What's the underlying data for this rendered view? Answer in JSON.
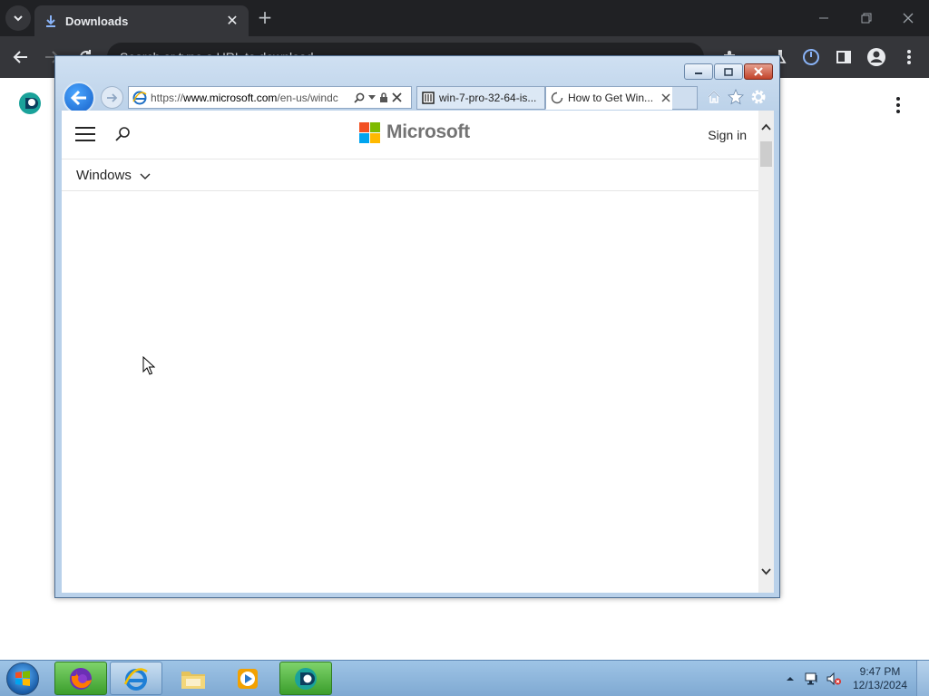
{
  "chrome": {
    "tab_title": "Downloads",
    "omnibox_text": "Search or type a URL to download",
    "colors": {
      "frame": "#202124",
      "toolbar": "#35363a",
      "text": "#e8eaed"
    }
  },
  "ie": {
    "address_url_prefix": "https://",
    "address_url_domain": "www.microsoft.com",
    "address_url_path": "/en-us/windc",
    "tabs": [
      {
        "label": "win-7-pro-32-64-is...",
        "icon": "archive-icon",
        "active": false
      },
      {
        "label": "How to Get Win...",
        "icon": "loading-spinner-icon",
        "active": true
      }
    ]
  },
  "microsoft_page": {
    "logo_text": "Microsoft",
    "sign_in": "Sign in",
    "subnav_label": "Windows",
    "logo_colors": [
      "#f25022",
      "#7fba00",
      "#00a4ef",
      "#ffb900"
    ]
  },
  "taskbar": {
    "apps": [
      "firefox-icon",
      "internet-explorer-icon",
      "file-explorer-icon",
      "media-player-icon",
      "chrome-extension-app-icon"
    ],
    "clock_time": "9:47 PM",
    "clock_date": "12/13/2024"
  }
}
